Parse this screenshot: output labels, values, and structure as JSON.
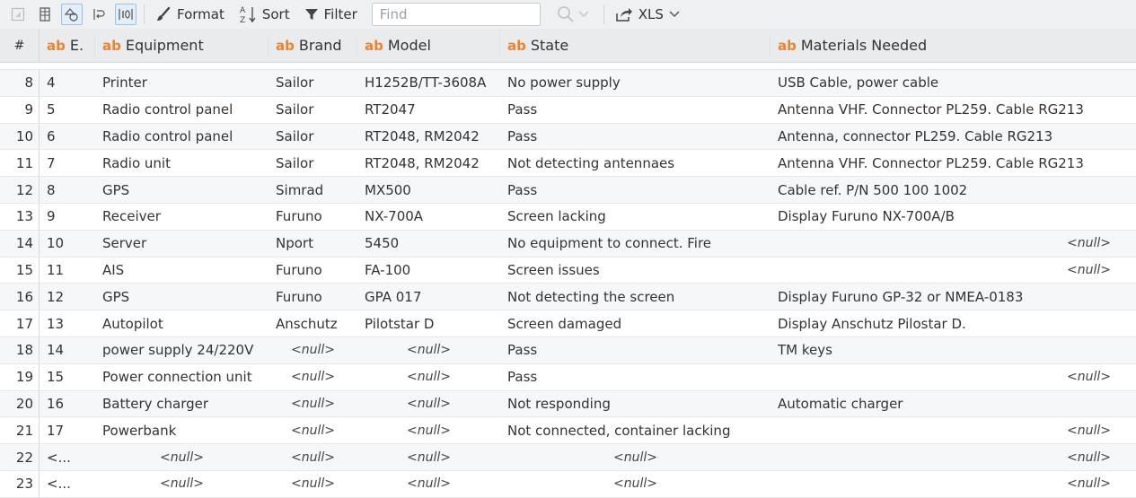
{
  "toolbar": {
    "format_label": "Format",
    "sort_label": "Sort",
    "filter_label": "Filter",
    "find_placeholder": "Find",
    "export_label": "XLS"
  },
  "columns": {
    "rownum": "#",
    "type_badge": "ab",
    "e": "E.",
    "equipment": "Equipment",
    "brand": "Brand",
    "model": "Model",
    "state": "State",
    "materials": "Materials Needed"
  },
  "rows": [
    {
      "n": "8",
      "e": "4",
      "equipment": "Printer",
      "brand": "Sailor",
      "model": "H1252B/TT-3608A",
      "state": "No power supply",
      "materials": "USB Cable, power cable"
    },
    {
      "n": "9",
      "e": "5",
      "equipment": "Radio control panel",
      "brand": "Sailor",
      "model": "RT2047",
      "state": "Pass",
      "materials": "Antenna VHF. Connector PL259. Cable RG213"
    },
    {
      "n": "10",
      "e": "6",
      "equipment": "Radio control panel",
      "brand": "Sailor",
      "model": "RT2048, RM2042",
      "state": "Pass",
      "materials": "Antenna, connector PL259. Cable RG213"
    },
    {
      "n": "11",
      "e": "7",
      "equipment": "Radio unit",
      "brand": "Sailor",
      "model": "RT2048, RM2042",
      "state": "Not detecting antennaes",
      "materials": "Antenna VHF. Connector PL259. Cable RG213"
    },
    {
      "n": "12",
      "e": "8",
      "equipment": "GPS",
      "brand": "Simrad",
      "model": "MX500",
      "state": "Pass",
      "materials": "Cable ref. P/N 500 100 1002"
    },
    {
      "n": "13",
      "e": "9",
      "equipment": "Receiver",
      "brand": "Furuno",
      "model": "NX-700A",
      "state": "Screen lacking",
      "materials": "Display Furuno NX-700A/B"
    },
    {
      "n": "14",
      "e": "10",
      "equipment": "Server",
      "brand": "Nport",
      "model": "5450",
      "state": "No equipment to connect. Fire",
      "materials": null
    },
    {
      "n": "15",
      "e": "11",
      "equipment": "AIS",
      "brand": "Furuno",
      "model": "FA-100",
      "state": "Screen issues",
      "materials": null
    },
    {
      "n": "16",
      "e": "12",
      "equipment": "GPS",
      "brand": "Furuno",
      "model": "GPA 017",
      "state": "Not detecting the screen",
      "materials": "Display Furuno GP-32 or NMEA-0183"
    },
    {
      "n": "17",
      "e": "13",
      "equipment": "Autopilot",
      "brand": "Anschutz",
      "model": "Pilotstar D",
      "state": "Screen damaged",
      "materials": "Display Anschutz Pilostar D."
    },
    {
      "n": "18",
      "e": "14",
      "equipment": "power supply 24/220V",
      "brand": null,
      "model": null,
      "state": "Pass",
      "materials": "TM keys"
    },
    {
      "n": "19",
      "e": "15",
      "equipment": "Power connection unit",
      "brand": null,
      "model": null,
      "state": "Pass",
      "materials": null
    },
    {
      "n": "20",
      "e": "16",
      "equipment": "Battery charger",
      "brand": null,
      "model": null,
      "state": "Not responding",
      "materials": "Automatic charger"
    },
    {
      "n": "21",
      "e": "17",
      "equipment": "Powerbank",
      "brand": null,
      "model": null,
      "state": "Not connected, container lacking",
      "materials": null
    },
    {
      "n": "22",
      "e": "<...",
      "equipment": null,
      "brand": null,
      "model": null,
      "state": null,
      "materials": null
    },
    {
      "n": "23",
      "e": "<...",
      "equipment": null,
      "brand": null,
      "model": null,
      "state": null,
      "materials": null
    }
  ],
  "null_text": "<null>"
}
